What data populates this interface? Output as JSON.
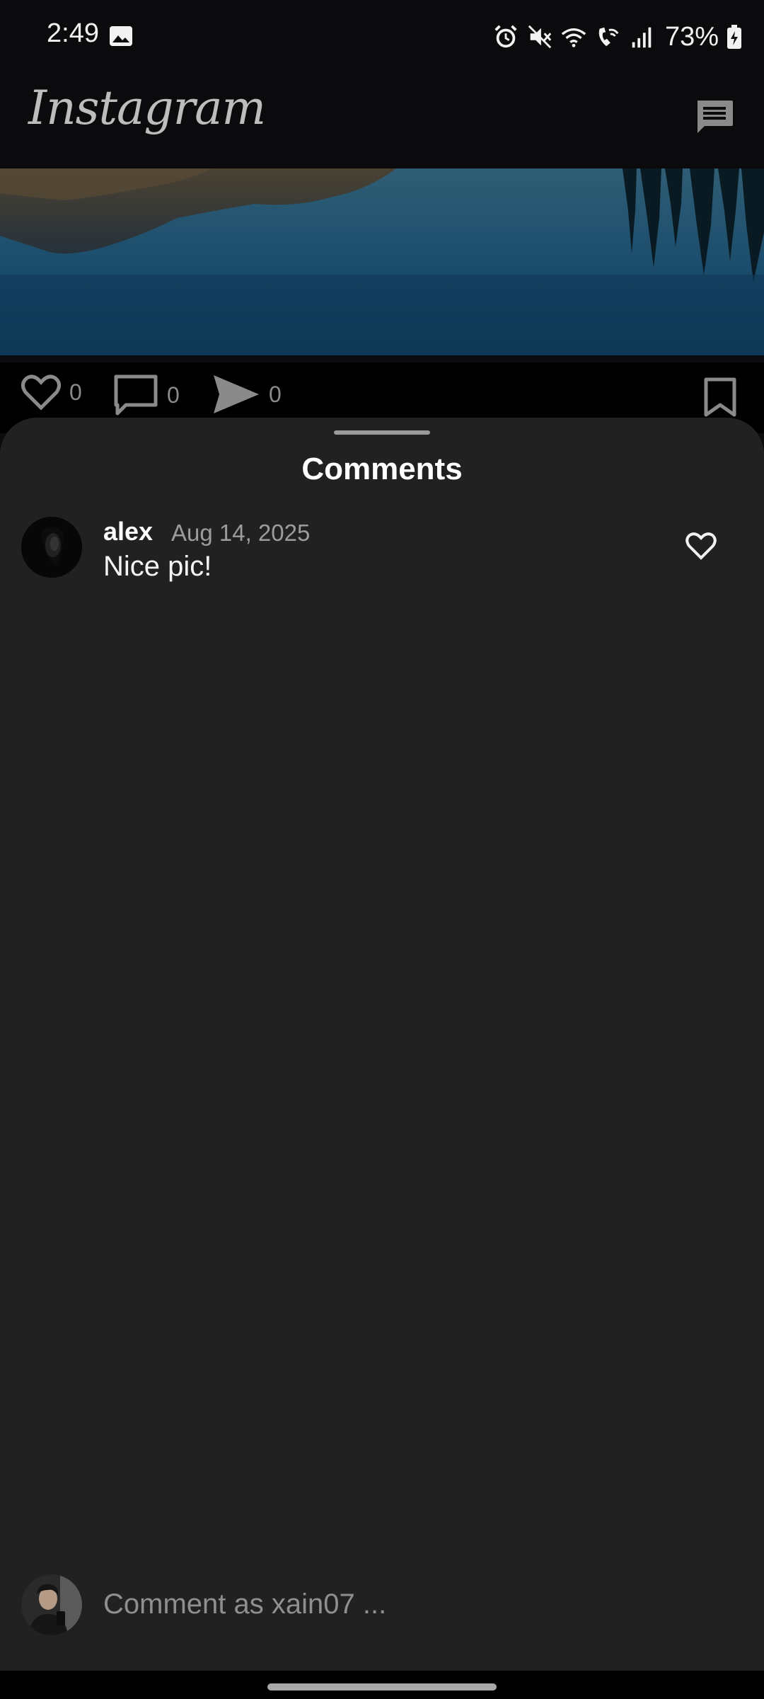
{
  "status_bar": {
    "time": "2:49",
    "battery_percent": "73%",
    "icons": [
      "gallery-icon",
      "alarm-icon",
      "mute-icon",
      "wifi-icon",
      "wifi-calling-icon",
      "signal-icon",
      "battery-charging-icon"
    ]
  },
  "header": {
    "logo_text": "Instagram",
    "messages_icon": "chat-icon"
  },
  "post": {
    "likes_count": "0",
    "comments_count": "0",
    "shares_count": "0"
  },
  "comments_sheet": {
    "title": "Comments",
    "comments": [
      {
        "username": "alex",
        "date": "Aug 14, 2025",
        "text": "Nice pic!"
      }
    ],
    "input_placeholder": "Comment as xain07 ..."
  },
  "colors": {
    "background": "#0b0b0d",
    "sheet": "#212121",
    "muted_text": "#9c9c9c"
  }
}
